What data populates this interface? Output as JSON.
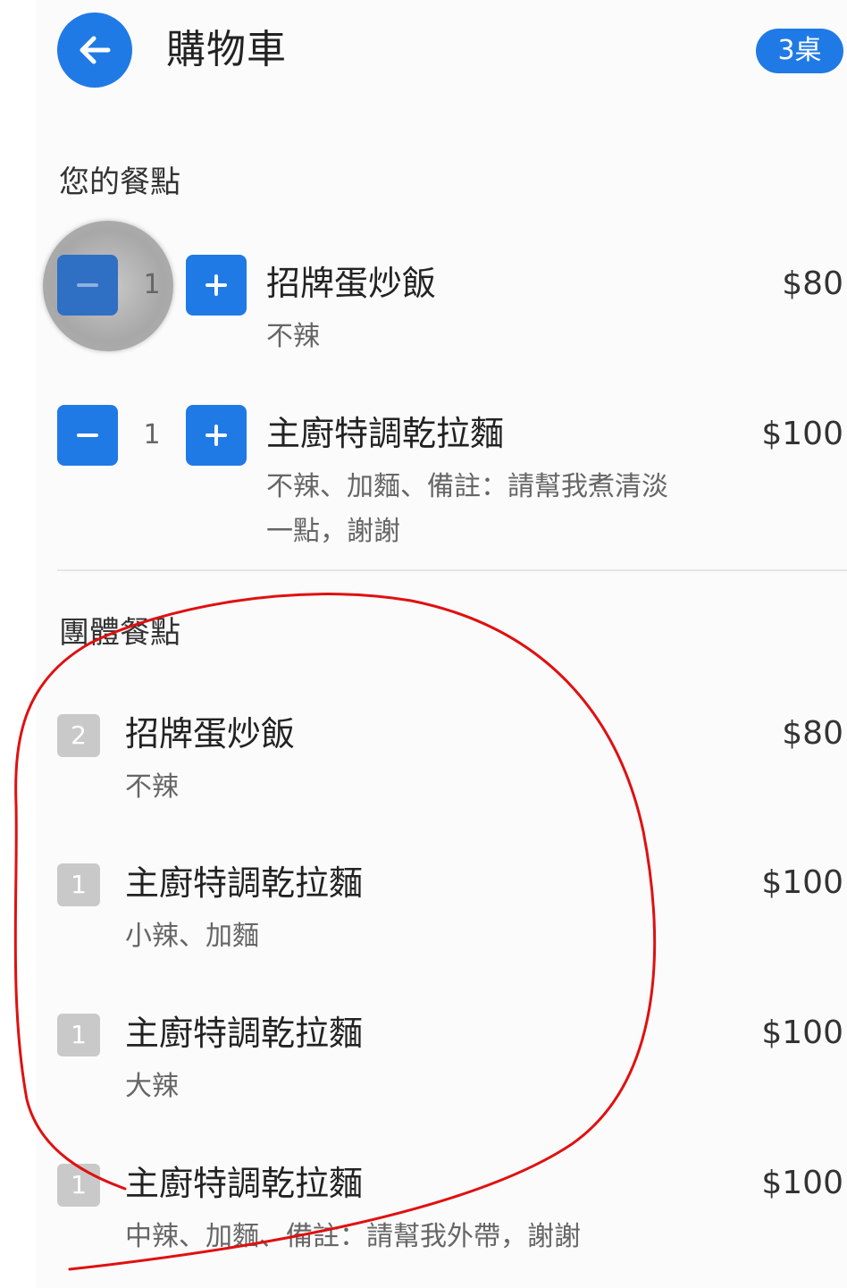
{
  "header": {
    "title": "購物車",
    "table_badge": "3桌"
  },
  "my_order": {
    "section_title": "您的餐點",
    "items": [
      {
        "quantity": "1",
        "name": "招牌蛋炒飯",
        "note": "不辣",
        "price": "$80"
      },
      {
        "quantity": "1",
        "name": "主廚特調乾拉麵",
        "note_line1": "不辣、加麵、備註：請幫我煮清淡",
        "note_line2": "一點，謝謝",
        "price": "$100"
      }
    ]
  },
  "group_order": {
    "section_title": "團體餐點",
    "items": [
      {
        "count": "2",
        "name": "招牌蛋炒飯",
        "note": "不辣",
        "price": "$80"
      },
      {
        "count": "1",
        "name": "主廚特調乾拉麵",
        "note": "小辣、加麵",
        "price": "$100"
      },
      {
        "count": "1",
        "name": "主廚特調乾拉麵",
        "note": "大辣",
        "price": "$100"
      },
      {
        "count": "1",
        "name": "主廚特調乾拉麵",
        "note": "中辣、加麵、備註：請幫我外帶，謝謝",
        "price": "$100"
      }
    ]
  },
  "icons": {
    "back": "arrow-left-icon",
    "minus": "minus-icon",
    "plus": "plus-icon"
  },
  "colors": {
    "accent": "#1f7ae6",
    "badge_gray": "#c9c9c9",
    "annotation_red": "#e01010"
  }
}
